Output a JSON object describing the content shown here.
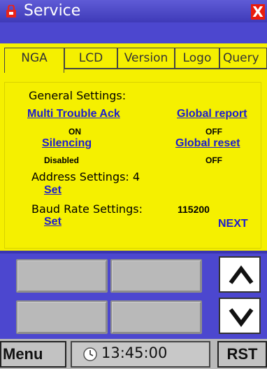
{
  "window": {
    "title": "Service",
    "close_glyph": "X",
    "app_icon": "lock-icon",
    "close_icon": "close-icon"
  },
  "tabs": [
    {
      "label": "NGA",
      "active": true
    },
    {
      "label": "LCD",
      "active": false
    },
    {
      "label": "Version",
      "active": false
    },
    {
      "label": "Logo",
      "active": false
    },
    {
      "label": "Query",
      "active": false
    }
  ],
  "panel": {
    "general_heading": "General Settings:",
    "multi_trouble_ack": {
      "label": "Multi Trouble Ack",
      "value": "ON"
    },
    "global_report": {
      "label": "Global report",
      "value": "OFF"
    },
    "silencing": {
      "label": "Silencing",
      "value": "Disabled"
    },
    "global_reset": {
      "label": "Global reset",
      "value": "OFF"
    },
    "address": {
      "label": "Address Settings: 4",
      "set_label": "Set"
    },
    "baud": {
      "label": "Baud Rate Settings:",
      "value": "115200",
      "set_label": "Set"
    },
    "next_label": "NEXT"
  },
  "controls": {
    "up_icon": "chevron-up-icon",
    "down_icon": "chevron-down-icon"
  },
  "taskbar": {
    "menu_label": "Menu",
    "time": "13:45:00",
    "clock_icon": "clock-icon",
    "rst_label": "RST"
  },
  "colors": {
    "background": "#f5f000",
    "title_bar": "#4c47cf",
    "link": "#1c1cd0",
    "close": "#ea1c0e",
    "button_gray": "#b9b9b9"
  }
}
